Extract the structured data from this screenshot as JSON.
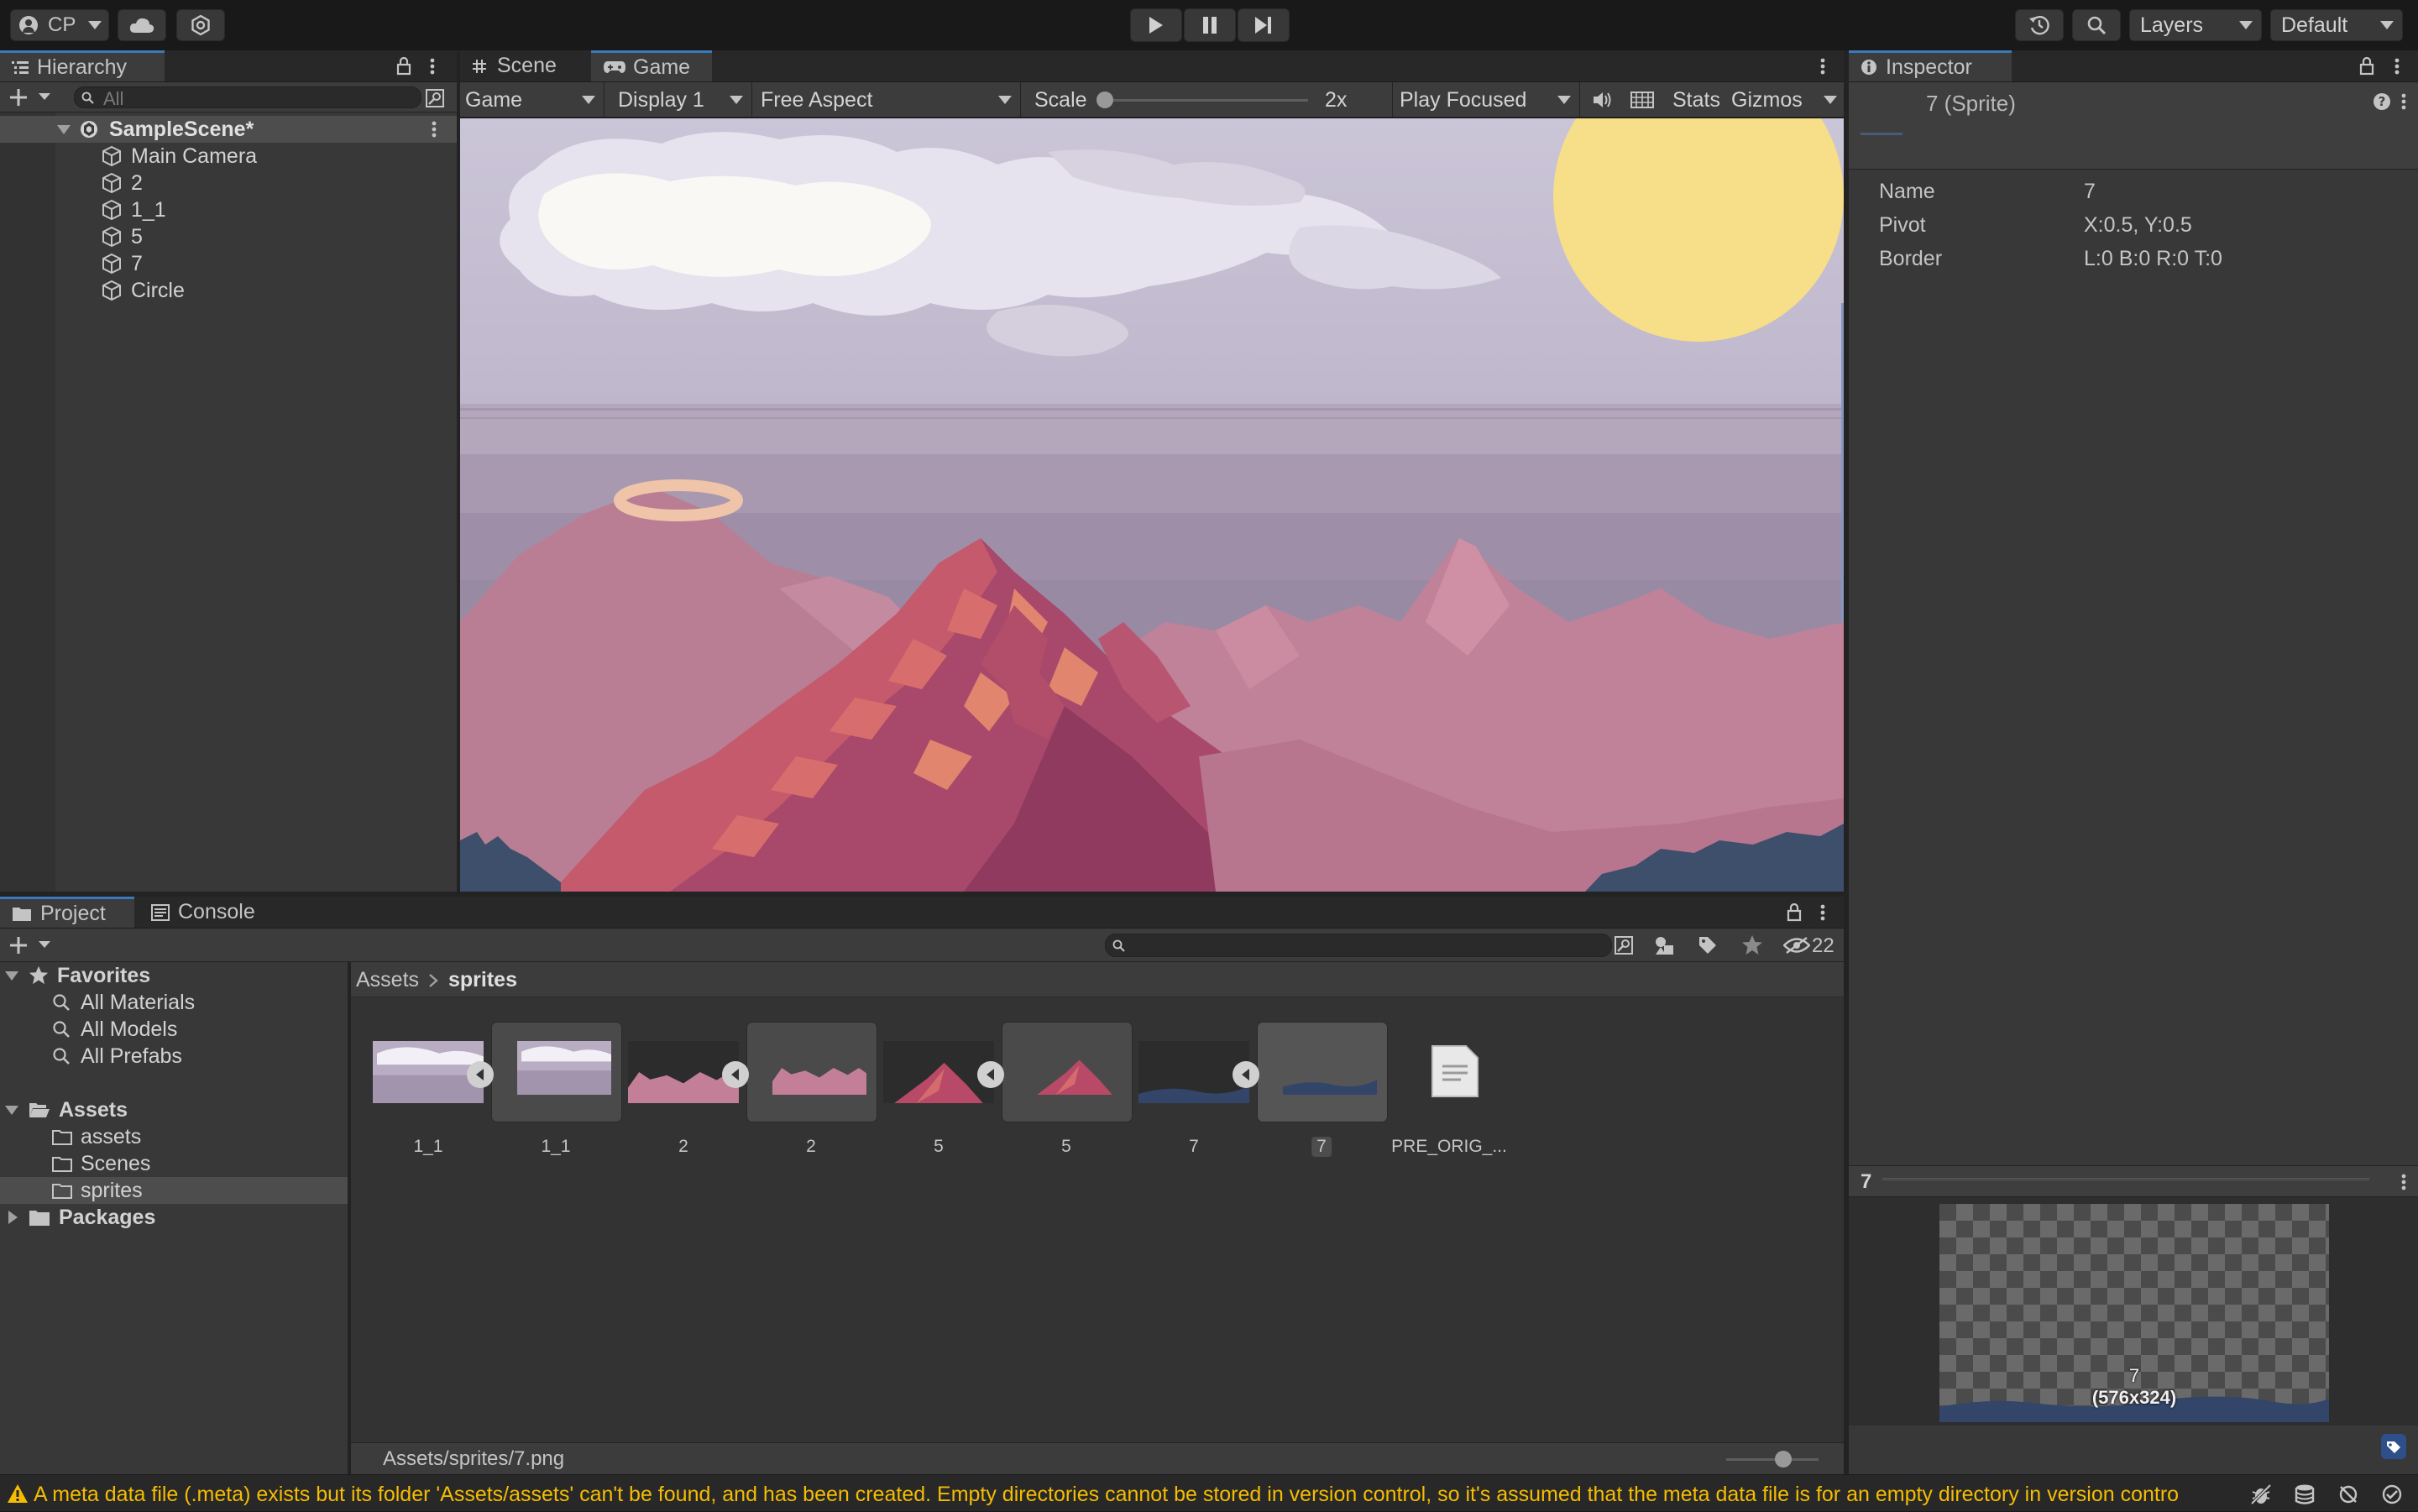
{
  "toolbar": {
    "account": "CP",
    "layers": "Layers",
    "layout": "Default"
  },
  "hierarchy": {
    "tab": "Hierarchy",
    "search_placeholder": "All",
    "scene": "SampleScene*",
    "objects": [
      "Main Camera",
      "2",
      "1_1",
      "5",
      "7",
      "Circle"
    ]
  },
  "view_tabs": {
    "scene": "Scene",
    "game": "Game"
  },
  "game_bar": {
    "mode": "Game",
    "display": "Display 1",
    "aspect": "Free Aspect",
    "scale_label": "Scale",
    "scale_value": "2x",
    "play_mode": "Play Focused",
    "stats": "Stats",
    "gizmos": "Gizmos"
  },
  "inspector": {
    "tab": "Inspector",
    "title": "7 (Sprite)",
    "props": [
      {
        "label": "Name",
        "value": "7"
      },
      {
        "label": "Pivot",
        "value": "X:0.5, Y:0.5"
      },
      {
        "label": "Border",
        "value": "L:0 B:0 R:0 T:0"
      }
    ],
    "preview_title": "7",
    "preview_name": "7",
    "preview_size": "(576x324)"
  },
  "project": {
    "tab_project": "Project",
    "tab_console": "Console",
    "hidden_count": "22",
    "favorites_label": "Favorites",
    "favorites": [
      "All Materials",
      "All Models",
      "All Prefabs"
    ],
    "assets_label": "Assets",
    "assets_children": [
      "assets",
      "Scenes",
      "sprites"
    ],
    "packages_label": "Packages",
    "breadcrumb": [
      "Assets",
      "sprites"
    ],
    "items": [
      {
        "name": "1_1",
        "kind": "texture",
        "scene": "sky"
      },
      {
        "name": "1_1",
        "kind": "sprite",
        "scene": "sky"
      },
      {
        "name": "2",
        "kind": "texture",
        "scene": "range"
      },
      {
        "name": "2",
        "kind": "sprite",
        "scene": "range"
      },
      {
        "name": "5",
        "kind": "texture",
        "scene": "peak"
      },
      {
        "name": "5",
        "kind": "sprite",
        "scene": "peak"
      },
      {
        "name": "7",
        "kind": "texture",
        "scene": "ground"
      },
      {
        "name": "7",
        "kind": "sprite",
        "scene": "ground"
      },
      {
        "name": "PRE_ORIG_...",
        "kind": "file",
        "scene": "none"
      }
    ],
    "status_path": "Assets/sprites/7.png"
  },
  "console_message": "A meta data file (.meta) exists but its folder 'Assets/assets' can't be found, and has been created. Empty directories cannot be stored in version control, so it's assumed that the meta data file is for an empty directory in version control.",
  "colors": {
    "accent": "#3a79bb",
    "selection": "#4d4d4d",
    "warning": "#f4bc02",
    "sun": "#f7de88"
  }
}
